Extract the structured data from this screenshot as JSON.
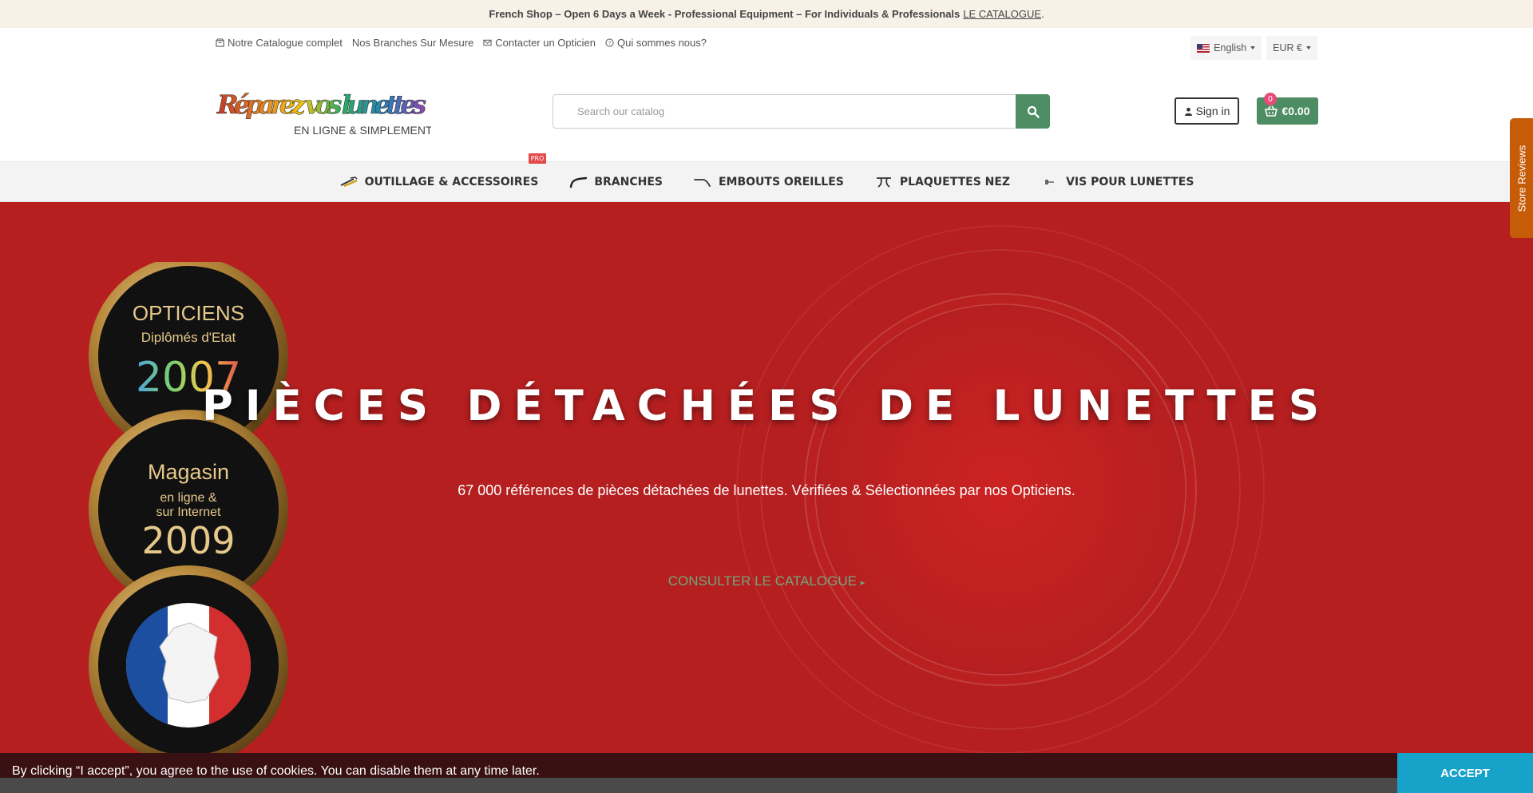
{
  "announcement": {
    "text": "French Shop – Open 6 Days a Week - Professional Equipment – For Individuals & Professionals",
    "link": "LE CATALOGUE",
    "suffix": "."
  },
  "topnav": {
    "items": [
      {
        "label": "Notre Catalogue complet",
        "icon": "box-icon"
      },
      {
        "label": "Nos Branches Sur Mesure"
      },
      {
        "label": "Contacter un Opticien",
        "icon": "envelope-icon"
      },
      {
        "label": "Qui sommes nous?",
        "icon": "question-circle-icon"
      }
    ],
    "language": "English",
    "currency": "EUR €"
  },
  "header": {
    "logo_title": "Réparez vos lunettes",
    "logo_tagline": "EN LIGNE & SIMPLEMENT",
    "search_placeholder": "Search our catalog",
    "signin_label": "Sign in",
    "cart_total": "€0.00",
    "cart_count": "0"
  },
  "menu": {
    "items": [
      {
        "label": "OUTILLAGE & ACCESSOIRES",
        "badge": "PRO"
      },
      {
        "label": "BRANCHES"
      },
      {
        "label": "EMBOUTS OREILLES"
      },
      {
        "label": "PLAQUETTES NEZ"
      },
      {
        "label": "VIS POUR LUNETTES"
      }
    ]
  },
  "hero": {
    "title": "PIÈCES DÉTACHÉES DE LUNETTES",
    "subtitle": "67 000 références de pièces détachées de lunettes. Vérifiées & Sélectionnées par nos Opticiens.",
    "cta": "CONSULTER LE CATALOGUE",
    "medals": [
      {
        "line1": "OPTICIENS",
        "line2": "Diplômés d'Etat",
        "year": "2007"
      },
      {
        "line1": "Magasin",
        "line2": "en ligne &",
        "line3": "sur Internet",
        "year": "2009"
      },
      {
        "map": "france-map-icon"
      }
    ],
    "colors": {
      "background": "#b61f20",
      "cta": "#6fa77b"
    }
  },
  "reviews_tab": "Store Reviews",
  "cookie": {
    "text": "By clicking “I accept”, you agree to the use of cookies. You can disable them at any time later.",
    "accept": "ACCEPT"
  },
  "colors": {
    "brand_green": "#4e8d63",
    "accept_blue": "#17a2c9",
    "reviews_orange": "#c65c08"
  }
}
